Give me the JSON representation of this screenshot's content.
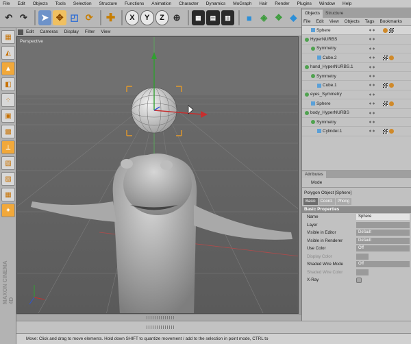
{
  "menubar": [
    "File",
    "Edit",
    "Objects",
    "Tools",
    "Selection",
    "Structure",
    "Functions",
    "Animation",
    "Character",
    "Dynamics",
    "MoGraph",
    "Hair",
    "Render",
    "Plugins",
    "Window",
    "Help"
  ],
  "toolbar": {
    "axis_x": "X",
    "axis_y": "Y",
    "axis_z": "Z"
  },
  "viewport_menu": [
    "Edit",
    "Cameras",
    "Display",
    "Filter",
    "View"
  ],
  "viewport_label": "Perspective",
  "brand": "MAXON CINEMA 4D",
  "object_manager": {
    "tabs": [
      "Objects",
      "Structure"
    ],
    "menu": [
      "File",
      "Edit",
      "View",
      "Objects",
      "Tags",
      "Bookmarks"
    ],
    "rows": [
      {
        "name": "Sphere",
        "indent": 1,
        "icon": "tri",
        "tags": [
          "orange",
          "check"
        ]
      },
      {
        "name": "HyperNURBS",
        "indent": 0,
        "icon": "green",
        "tags": []
      },
      {
        "name": "Symmetry",
        "indent": 1,
        "icon": "green",
        "tags": []
      },
      {
        "name": "Cube.2",
        "indent": 2,
        "icon": "tri",
        "tags": [
          "check",
          "orange"
        ]
      },
      {
        "name": "hand_HyperNURBS.1",
        "indent": 0,
        "icon": "green",
        "tags": []
      },
      {
        "name": "Symmetry",
        "indent": 1,
        "icon": "green",
        "tags": []
      },
      {
        "name": "Cube.1",
        "indent": 2,
        "icon": "tri",
        "tags": [
          "check",
          "orange"
        ]
      },
      {
        "name": "eyes_Symmetry",
        "indent": 0,
        "icon": "green",
        "tags": []
      },
      {
        "name": "Sphere",
        "indent": 1,
        "icon": "tri",
        "tags": [
          "check",
          "orange"
        ]
      },
      {
        "name": "body_HyperNURBS",
        "indent": 0,
        "icon": "green",
        "tags": []
      },
      {
        "name": "Symmetry",
        "indent": 1,
        "icon": "green",
        "tags": []
      },
      {
        "name": "Cylinder.1",
        "indent": 2,
        "icon": "tri",
        "tags": [
          "check",
          "orange"
        ]
      }
    ]
  },
  "attributes": {
    "tab": "Attributes",
    "mode_label": "Mode",
    "object_title": "Polygon Object [Sphere]",
    "subtabs": [
      "Basic",
      "Coord.",
      "Phong"
    ],
    "section": "Basic Properties",
    "fields": [
      {
        "label": "Name",
        "value": "Sphere",
        "kind": "light",
        "disabled": false
      },
      {
        "label": "Layer",
        "value": "",
        "kind": "field",
        "disabled": false
      },
      {
        "label": "Visible in Editor",
        "value": "Default",
        "kind": "field",
        "disabled": false
      },
      {
        "label": "Visible in Renderer",
        "value": "Default",
        "kind": "field",
        "disabled": false
      },
      {
        "label": "Use Color",
        "value": "Off",
        "kind": "field",
        "disabled": false
      },
      {
        "label": "Display Color",
        "value": "",
        "kind": "small",
        "disabled": true
      },
      {
        "label": "Shaded Wire Mode",
        "value": "Off",
        "kind": "field",
        "disabled": false
      },
      {
        "label": "Shaded Wire Color",
        "value": "",
        "kind": "small",
        "disabled": true
      },
      {
        "label": "X-Ray",
        "value": "",
        "kind": "check",
        "disabled": false
      }
    ]
  },
  "status": "Move: Click and drag to move elements. Hold down SHIFT to quantize movement / add to the selection in point mode, CTRL to"
}
